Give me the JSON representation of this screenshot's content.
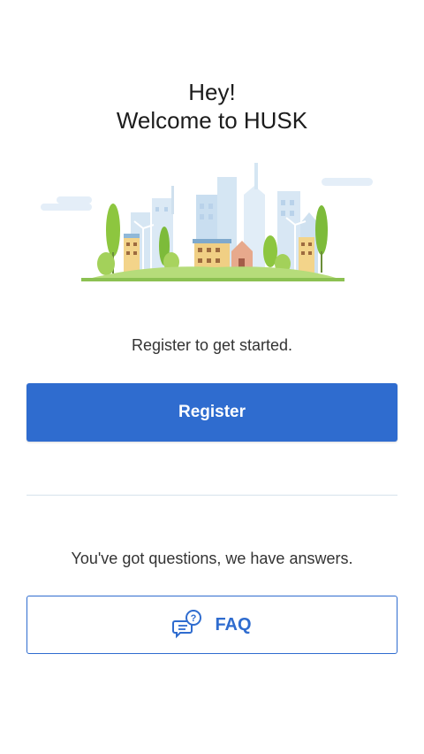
{
  "welcome": {
    "line1": "Hey!",
    "line2": "Welcome to HUSK"
  },
  "illustration": {
    "icon": "city-skyline-illustration"
  },
  "register": {
    "prompt": "Register to get started.",
    "button_label": "Register"
  },
  "faq": {
    "prompt": "You've got questions, we have answers.",
    "button_label": "FAQ",
    "icon": "faq-chat-icon"
  },
  "colors": {
    "primary": "#2f6ccf",
    "divider": "#d7e2ec",
    "background": "#ffffff"
  }
}
